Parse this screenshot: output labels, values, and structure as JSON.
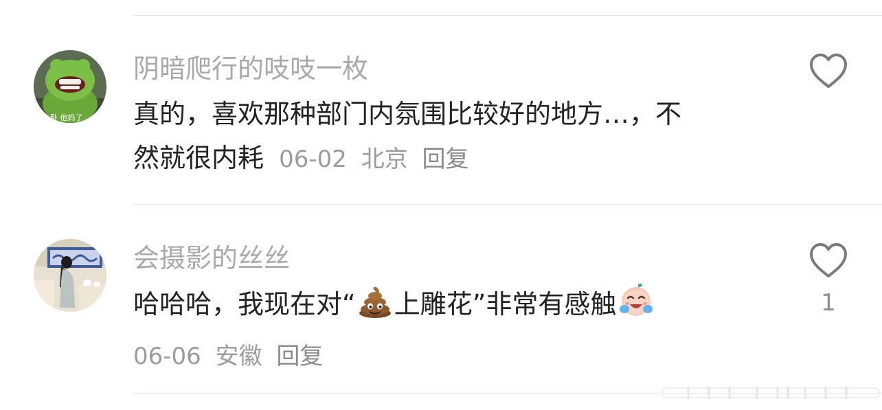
{
  "comments": [
    {
      "username": "阴暗爬行的吱吱一枚",
      "text_line1": "真的，喜欢那种部门内氛围比较好的地方…，不",
      "text_line2": "然就很内耗",
      "date": "06-02",
      "location": "北京",
      "reply_label": "回复",
      "avatar_caption": "卧 他妈了",
      "like_icon": "heart-outline-icon",
      "like_count": ""
    },
    {
      "username": "会摄影的丝丝",
      "text_before_emoji": "哈哈哈，我现在对“",
      "emoji_1": "poop-emoji",
      "text_after_emoji": "上雕花”非常有感触",
      "emoji_2": "crying-laughing-baby-emoji",
      "date": "06-06",
      "location": "安徽",
      "reply_label": "回复",
      "like_icon": "heart-outline-icon",
      "like_count": "1"
    }
  ],
  "colors": {
    "username": "#a9a9a9",
    "body_text": "#222222",
    "meta": "#9c9c9c",
    "divider": "#e8e8e8",
    "icon": "#7a7a7a"
  }
}
